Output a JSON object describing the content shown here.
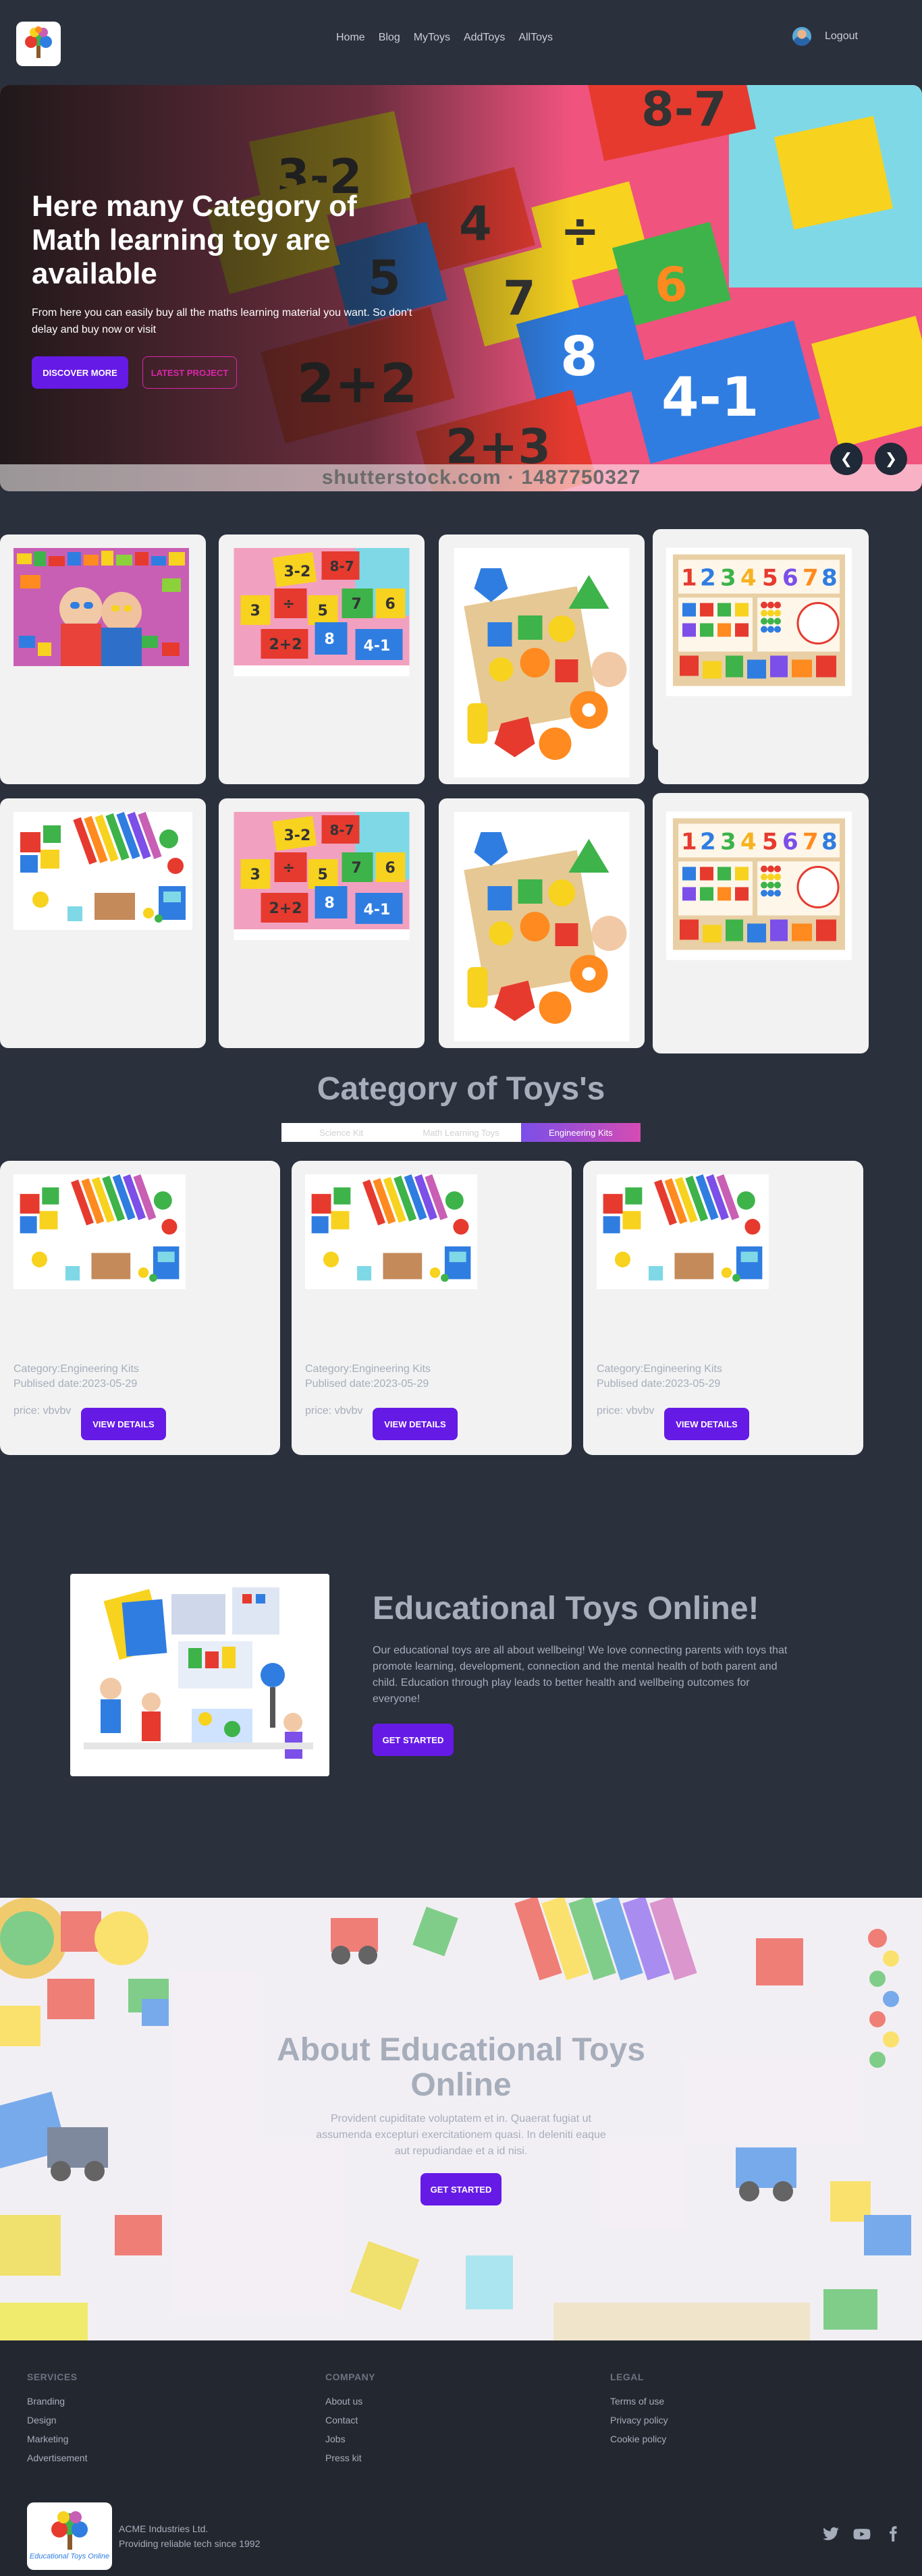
{
  "nav": {
    "links": [
      "Home",
      "Blog",
      "MyToys",
      "AddToys",
      "AllToys"
    ],
    "logout": "Logout"
  },
  "hero": {
    "title": "Here many Category of Math learning toy are available",
    "subtitle": "From here you can easily buy all the maths learning material you want. So don't delay and buy now or visit",
    "btn_discover": "DISCOVER MORE",
    "btn_latest": "LATEST PROJECT",
    "watermark": "shutterstock.com · 1487750327",
    "prev": "❮",
    "next": "❯"
  },
  "category": {
    "title": "Category of Toys's",
    "tabs": [
      "Science Kit",
      "Math Learning Toys",
      "Engineering Kits"
    ],
    "products": [
      {
        "category": "Category:Engineering Kits",
        "date": "Publised date:2023-05-29",
        "price": "price: vbvbv",
        "button": "VIEW DETAILS"
      },
      {
        "category": "Category:Engineering Kits",
        "date": "Publised date:2023-05-29",
        "price": "price: vbvbv",
        "button": "VIEW DETAILS"
      },
      {
        "category": "Category:Engineering Kits",
        "date": "Publised date:2023-05-29",
        "price": "price: vbvbv",
        "button": "VIEW DETAILS"
      }
    ]
  },
  "edu": {
    "title": "Educational Toys Online!",
    "text": "Our educational toys are all about wellbeing! We love connecting parents with toys that promote learning, development, connection and the mental health of both parent and child. Education through play leads to better health and wellbeing outcomes for everyone!",
    "button": "GET STARTED"
  },
  "about": {
    "title": "About Educational Toys Online",
    "text": "Provident cupiditate voluptatem et in. Quaerat fugiat ut assumenda excepturi exercitationem quasi. In deleniti eaque aut repudiandae et a id nisi.",
    "button": "GET STARTED"
  },
  "footer": {
    "services": {
      "title": "SERVICES",
      "items": [
        "Branding",
        "Design",
        "Marketing",
        "Advertisement"
      ]
    },
    "company": {
      "title": "COMPANY",
      "items": [
        "About us",
        "Contact",
        "Jobs",
        "Press kit"
      ]
    },
    "legal": {
      "title": "LEGAL",
      "items": [
        "Terms of use",
        "Privacy policy",
        "Cookie policy"
      ]
    },
    "company_name": "ACME Industries Ltd.",
    "tagline": "Providing reliable tech since 1992",
    "logo_text": "Educational Toys Online"
  },
  "colors": {
    "primary": "#661ae6",
    "secondary": "#d926a9",
    "bg": "#2a303c",
    "card": "#f2f2f2"
  },
  "icons": [
    "twitter-icon",
    "youtube-icon",
    "facebook-icon",
    "logo-tree-icon"
  ]
}
